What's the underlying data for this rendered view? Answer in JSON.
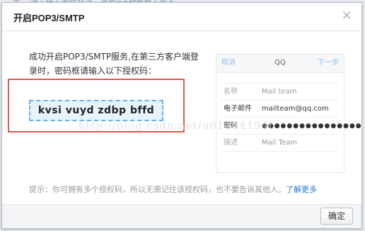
{
  "background": {
    "obscured_text": "正... 请入输入密码验证，使用QQ邮箱帮心安全..."
  },
  "dialog": {
    "title": "开启POP3/SMTP",
    "close_glyph": "×",
    "instruction": "成功开启POP3/SMTP服务,在第三方客户端登录时，密码框请输入以下授权码：",
    "auth_code": "kvsi vuyd zdbp bffd",
    "tip_prefix": "提示：你可拥有多个授权码，所以无需记住该授权码，也不要告诉其他人。",
    "tip_link": "了解更多",
    "ok_label": "确定"
  },
  "phone_mock": {
    "cancel": "取消",
    "title": "QQ",
    "next": "下一步",
    "rows": [
      {
        "key": "名称",
        "value": "Mail team"
      },
      {
        "key": "电子邮件",
        "value": "mailteam@qq.com"
      },
      {
        "key": "密码",
        "value": "●●●●●●●●●●●●●●●●"
      },
      {
        "key": "描述",
        "value": "Mail Team"
      }
    ]
  },
  "watermark": "http://blog.csdn.net/u011541946",
  "colors": {
    "highlight_border": "#e05a4a",
    "code_border": "#6ab0e8",
    "link": "#2a7ad1",
    "phone_nav_link": "#8fc0ec"
  }
}
